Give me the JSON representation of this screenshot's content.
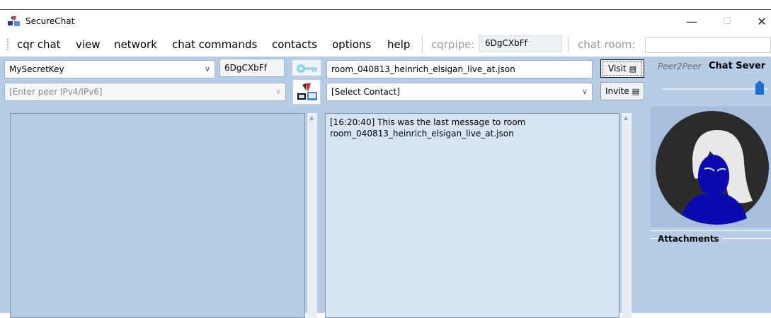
{
  "window": {
    "title": "SecureChat",
    "minimize_icon": "minimize-icon",
    "maximize_icon": "maximize-icon",
    "close_icon": "close-icon"
  },
  "menu": {
    "items": [
      "cqr chat",
      "view",
      "network",
      "chat commands",
      "contacts",
      "options",
      "help"
    ],
    "cqrpipe_label": "cqrpipe:",
    "cqrpipe_value": "6DgCXbFf",
    "chat_room_label": "chat room:"
  },
  "toolbar": {
    "secret_key_value": "MySecretKey",
    "key_hash": "6DgCXbFf",
    "room_file": "room_040813_heinrich_elsigan_live_at.json",
    "visit_label": "Visit",
    "peer_placeholder": "[Enter peer IPv4/IPv6]",
    "contact_value": "[Select Contact]",
    "invite_label": "Invite"
  },
  "side": {
    "mode_left": "Peer2Peer",
    "mode_right": "Chat Sever",
    "attachments_label": "Attachments",
    "slider_value": 1.0
  },
  "messages": {
    "text": "[16:20:40] This was the last message to room\nroom_040813_heinrich_elsigan_live_at.json"
  },
  "colors": {
    "panel": "#b7cde6",
    "message_pane": "#d7e4f3",
    "slider_accent": "#1f6fd0"
  }
}
